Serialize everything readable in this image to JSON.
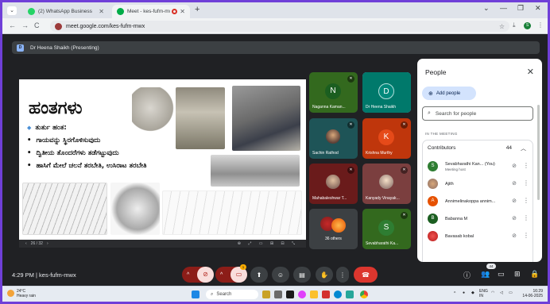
{
  "browser": {
    "tabs": [
      {
        "title": "(2) WhatsApp Business",
        "close": "✕"
      },
      {
        "title": "Meet - kes-fufm-mwx",
        "close": "✕"
      }
    ],
    "new_tab": "+",
    "window_controls": [
      "⌄",
      "—",
      "❐",
      "✕"
    ],
    "nav": [
      "←",
      "→",
      "C"
    ],
    "url": "meet.google.com/kes-fufm-mwx",
    "profile_initial": "S"
  },
  "presenting": {
    "badge": "D",
    "label": "Dr Heena Shaikh (Presenting)"
  },
  "slide": {
    "title": "ಹಂತಗಳು",
    "subtitle": "ತುರ್ತು ಹಂತ:",
    "bullets": [
      "ಗಾಯವನ್ನು ಸ್ಥಿರಗೊಳಿಸುವುದು",
      "ದ್ವಿತೀಯ ತೊಂದರೆಗಳು ತಡೆಗಟ್ಟುವುದು",
      "ಹಾಸಿಗೆ ಮೇಲೆ ಚಲನೆ ತರಬೇತಿ, ಉಸಿರಾಟ ತರಬೇತಿ"
    ],
    "page": "26 / 32",
    "nav_prev": "‹",
    "nav_next": "›",
    "tools": "⊕ ⤢ ▭ ⊞ ⊟ ⤡"
  },
  "tiles": [
    {
      "name": "Naganna Kaman...",
      "initial": "N",
      "bg": "#33691e",
      "avatar_bg": "#1b5e20",
      "muted": true
    },
    {
      "name": "Dr Heena Shaikh",
      "initial": "D",
      "bg": "#00796b",
      "avatar_bg": "#00897b",
      "muted": false
    },
    {
      "name": "Sachin Rathod",
      "initial": "",
      "bg": "#1e5457",
      "avatar_bg": "#5d4037",
      "muted": true
    },
    {
      "name": "Krishna Murthy",
      "initial": "K",
      "bg": "#bf360c",
      "avatar_bg": "#e64a19",
      "muted": true
    },
    {
      "name": "Mahabaleshwar T...",
      "initial": "",
      "bg": "#6a1b1b",
      "avatar_bg": "#8d6e63",
      "muted": true
    },
    {
      "name": "Kanyady Vinayak...",
      "initial": "",
      "bg": "#7b3f3f",
      "avatar_bg": "#a1887f",
      "muted": true
    },
    {
      "name": "36 others",
      "initial": "",
      "bg": "#3c4043",
      "avatar_bg": "#c62828",
      "muted": false
    },
    {
      "name": "Sevabharathi Ka...",
      "initial": "S",
      "bg": "#33691e",
      "avatar_bg": "#2e7d32",
      "muted": true
    }
  ],
  "people": {
    "title": "People",
    "close": "✕",
    "add_label": "Add people",
    "search_placeholder": "Search for people",
    "section_label": "IN THE MEETING",
    "group_label": "Contributors",
    "group_count": "44",
    "list": [
      {
        "name": "Sevabharathi Kan...  (You)",
        "sub": "Meeting host",
        "initial": "S",
        "color": "#2e7d32"
      },
      {
        "name": "Ajith",
        "sub": "",
        "initial": "",
        "color": "#8d6e63"
      },
      {
        "name": "Annimelinakoppa annim...",
        "sub": "",
        "initial": "A",
        "color": "#e65100"
      },
      {
        "name": "Babanna M",
        "sub": "",
        "initial": "B",
        "color": "#1b5e20"
      },
      {
        "name": "Bavasab kobal",
        "sub": "",
        "initial": "",
        "color": "#c62828"
      }
    ]
  },
  "bottom": {
    "time_code": "4:29 PM  |  kes-fufm-mwx",
    "people_count": "44",
    "host_badge": "1"
  },
  "taskbar": {
    "temp": "24°C",
    "weather": "Heavy rain",
    "search": "Search",
    "lang": "ENG\nIN",
    "clock_time": "16:29",
    "clock_date": "14-06-2025"
  }
}
